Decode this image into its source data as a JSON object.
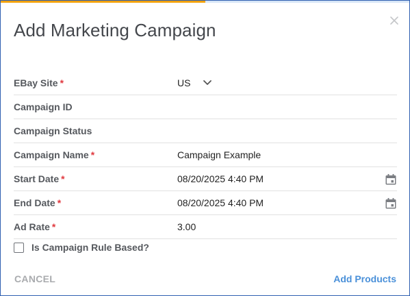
{
  "dialog": {
    "title": "Add Marketing Campaign",
    "progress_fraction": 0.5,
    "colors": {
      "accent": "#4a90d9",
      "progress": "#f2a20c",
      "required": "#e0383e"
    }
  },
  "fields": {
    "ebay_site": {
      "label": "EBay Site",
      "required_mark": "*",
      "value": "US"
    },
    "campaign_id": {
      "label": "Campaign ID",
      "value": ""
    },
    "campaign_status": {
      "label": "Campaign Status",
      "value": ""
    },
    "campaign_name": {
      "label": "Campaign Name",
      "required_mark": "*",
      "value": "Campaign Example"
    },
    "start_date": {
      "label": "Start Date",
      "required_mark": "*",
      "value": "08/20/2025 4:40 PM"
    },
    "end_date": {
      "label": "End Date",
      "required_mark": "*",
      "value": "08/20/2025 4:40 PM"
    },
    "ad_rate": {
      "label": "Ad Rate",
      "required_mark": "*",
      "value": "3.00"
    }
  },
  "rule_based": {
    "label": "Is Campaign Rule Based?",
    "checked": false
  },
  "actions": {
    "cancel_label": "CANCEL",
    "add_products_label": "Add Products"
  },
  "icons": {
    "close": "close-icon",
    "dropdown": "chevron-down-icon",
    "calendar": "calendar-icon"
  }
}
